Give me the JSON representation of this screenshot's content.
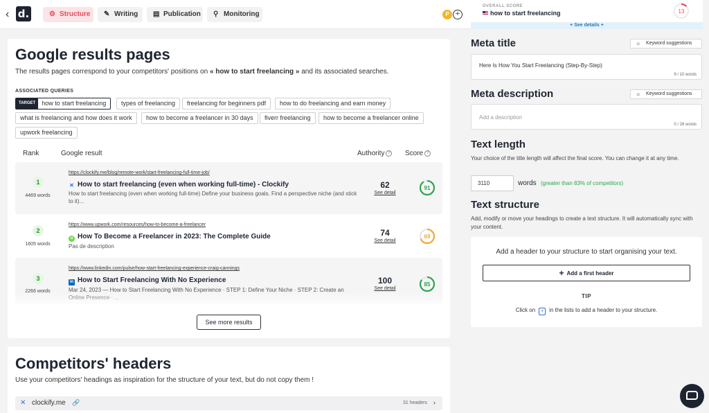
{
  "topbar": {
    "back_icon": "chevron-left-icon",
    "logo_letter": "d.",
    "tabs": [
      {
        "label": "Structure",
        "icon": "gear-icon",
        "active": true
      },
      {
        "label": "Writing",
        "icon": "pen-icon",
        "active": false
      },
      {
        "label": "Publication",
        "icon": "document-icon",
        "active": false
      },
      {
        "label": "Monitoring",
        "icon": "magnifier-icon",
        "active": false
      }
    ],
    "avatar_letter": "P",
    "accent_color": "#e94a59"
  },
  "score_panel": {
    "label": "OVERALL SCORE",
    "query": "how to start freelancing",
    "score": "13",
    "score_fraction": 0.13,
    "score_color": "#e94a59",
    "see_details": "+ See details +"
  },
  "results": {
    "title": "Google results pages",
    "subtitle_prefix": "The results pages correspond to your competitors' positions on ",
    "subtitle_query": "« how to start freelancing »",
    "subtitle_suffix": " and its associated searches.",
    "assoc_label": "ASSOCIATED QUERIES",
    "target_tag": "TARGET",
    "queries": [
      "how to start freelancing",
      "types of freelancing",
      "freelancing for beginners pdf",
      "how to do freelancing and earn money",
      "what is freelancing and how does it work",
      "how to become a freelancer in 30 days",
      "fiverr freelancing",
      "how to become a freelancer online",
      "upwork freelancing"
    ],
    "columns": {
      "rank": "Rank",
      "result": "Google result",
      "authority": "Authority",
      "score": "Score"
    },
    "rows": [
      {
        "rank": "1",
        "words": "4469 words",
        "url": "https://clockify.me/blog/remote-work/start-freelancing-full-time-job/",
        "title": "How to start freelancing (even when working full-time) - Clockify",
        "icon": "clockify-icon",
        "desc": "How to start freelancing (even when working full-time) Define your business goals. Find a perspective niche (and stick to it)...",
        "authority": "62",
        "see_detail": "See detail",
        "score": "91",
        "score_fraction": 0.91,
        "score_color": "#2ea44f"
      },
      {
        "rank": "2",
        "words": "1605 words",
        "url": "https://www.upwork.com/resources/how-to-become-a-freelancer",
        "title": "How To Become a Freelancer in 2023: The Complete Guide",
        "icon": "upwork-icon",
        "desc": "Pas de description",
        "authority": "74",
        "see_detail": "See detail",
        "score": "69",
        "score_fraction": 0.69,
        "score_color": "#f0a93b"
      },
      {
        "rank": "3",
        "words": "2266 words",
        "url": "https://www.linkedin.com/pulse/how-start-freelancing-experience-craig-cannings",
        "title": "How to Start Freelancing With No Experience",
        "icon": "linkedin-icon",
        "desc": "Mar 24, 2023 — How to Start Freelancing With No Experience · STEP 1: Define Your Niche · STEP 2: Create an Online Presence · ...",
        "authority": "100",
        "see_detail": "See detail",
        "score": "85",
        "score_fraction": 0.85,
        "score_color": "#2ea44f"
      }
    ],
    "see_more": "See more results"
  },
  "competitors": {
    "title": "Competitors' headers",
    "subtitle": "Use your competitors' headings as inspiration for the structure of your text, but do not copy them !",
    "first": {
      "name": "clockify.me",
      "count": "31 headers",
      "icon": "clockify-icon"
    }
  },
  "meta_title": {
    "heading": "Meta title",
    "kw_button": "Keyword suggestions",
    "value": "Here Is How You Start Freelancing (Step-By-Step)",
    "count": "9 / 10 words"
  },
  "meta_description": {
    "heading": "Meta description",
    "kw_button": "Keyword suggestions",
    "placeholder": "Add a description",
    "count": "0 / 26 words"
  },
  "text_length": {
    "heading": "Text length",
    "desc": "Your choice of the title length will affect the final score. You can change it at any time.",
    "value": "3110",
    "unit": "words",
    "compare": "(greater than 83% of competitors)"
  },
  "text_structure": {
    "heading": "Text structure",
    "desc": "Add, modify or move your headings to create a text structure. It will automatically sync with your content.",
    "empty_msg": "Add a header to your structure to start organising your text.",
    "add_button": "Add a first header",
    "tip_label": "TIP",
    "tip_before": "Click on",
    "tip_after": "in the lists to add a header to your structure."
  }
}
